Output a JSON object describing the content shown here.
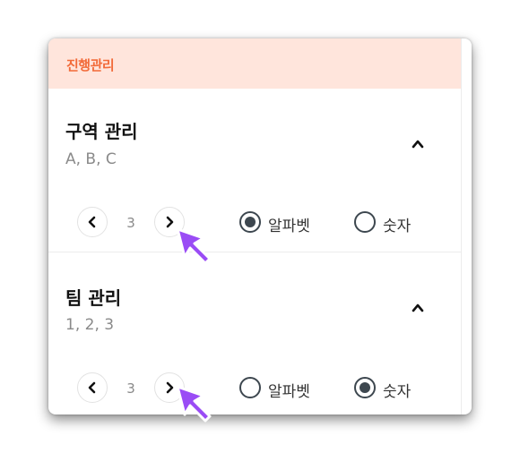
{
  "header": {
    "title": "진행관리"
  },
  "sections": [
    {
      "title": "구역 관리",
      "subtitle": "A, B, C",
      "page": "3",
      "options": [
        {
          "label": "알파벳",
          "selected": true
        },
        {
          "label": "숫자",
          "selected": false
        }
      ]
    },
    {
      "title": "팀 관리",
      "subtitle": "1, 2, 3",
      "page": "3",
      "options": [
        {
          "label": "알파벳",
          "selected": false
        },
        {
          "label": "숫자",
          "selected": true
        }
      ]
    }
  ],
  "colors": {
    "header_bg": "#ffe5dc",
    "header_text": "#f26b3a",
    "radio": "#3d474f",
    "cursor": "#9a4cf5"
  },
  "icons": [
    "chevron-up-icon",
    "chevron-left-icon",
    "chevron-right-icon",
    "pointer-cursor-icon"
  ]
}
